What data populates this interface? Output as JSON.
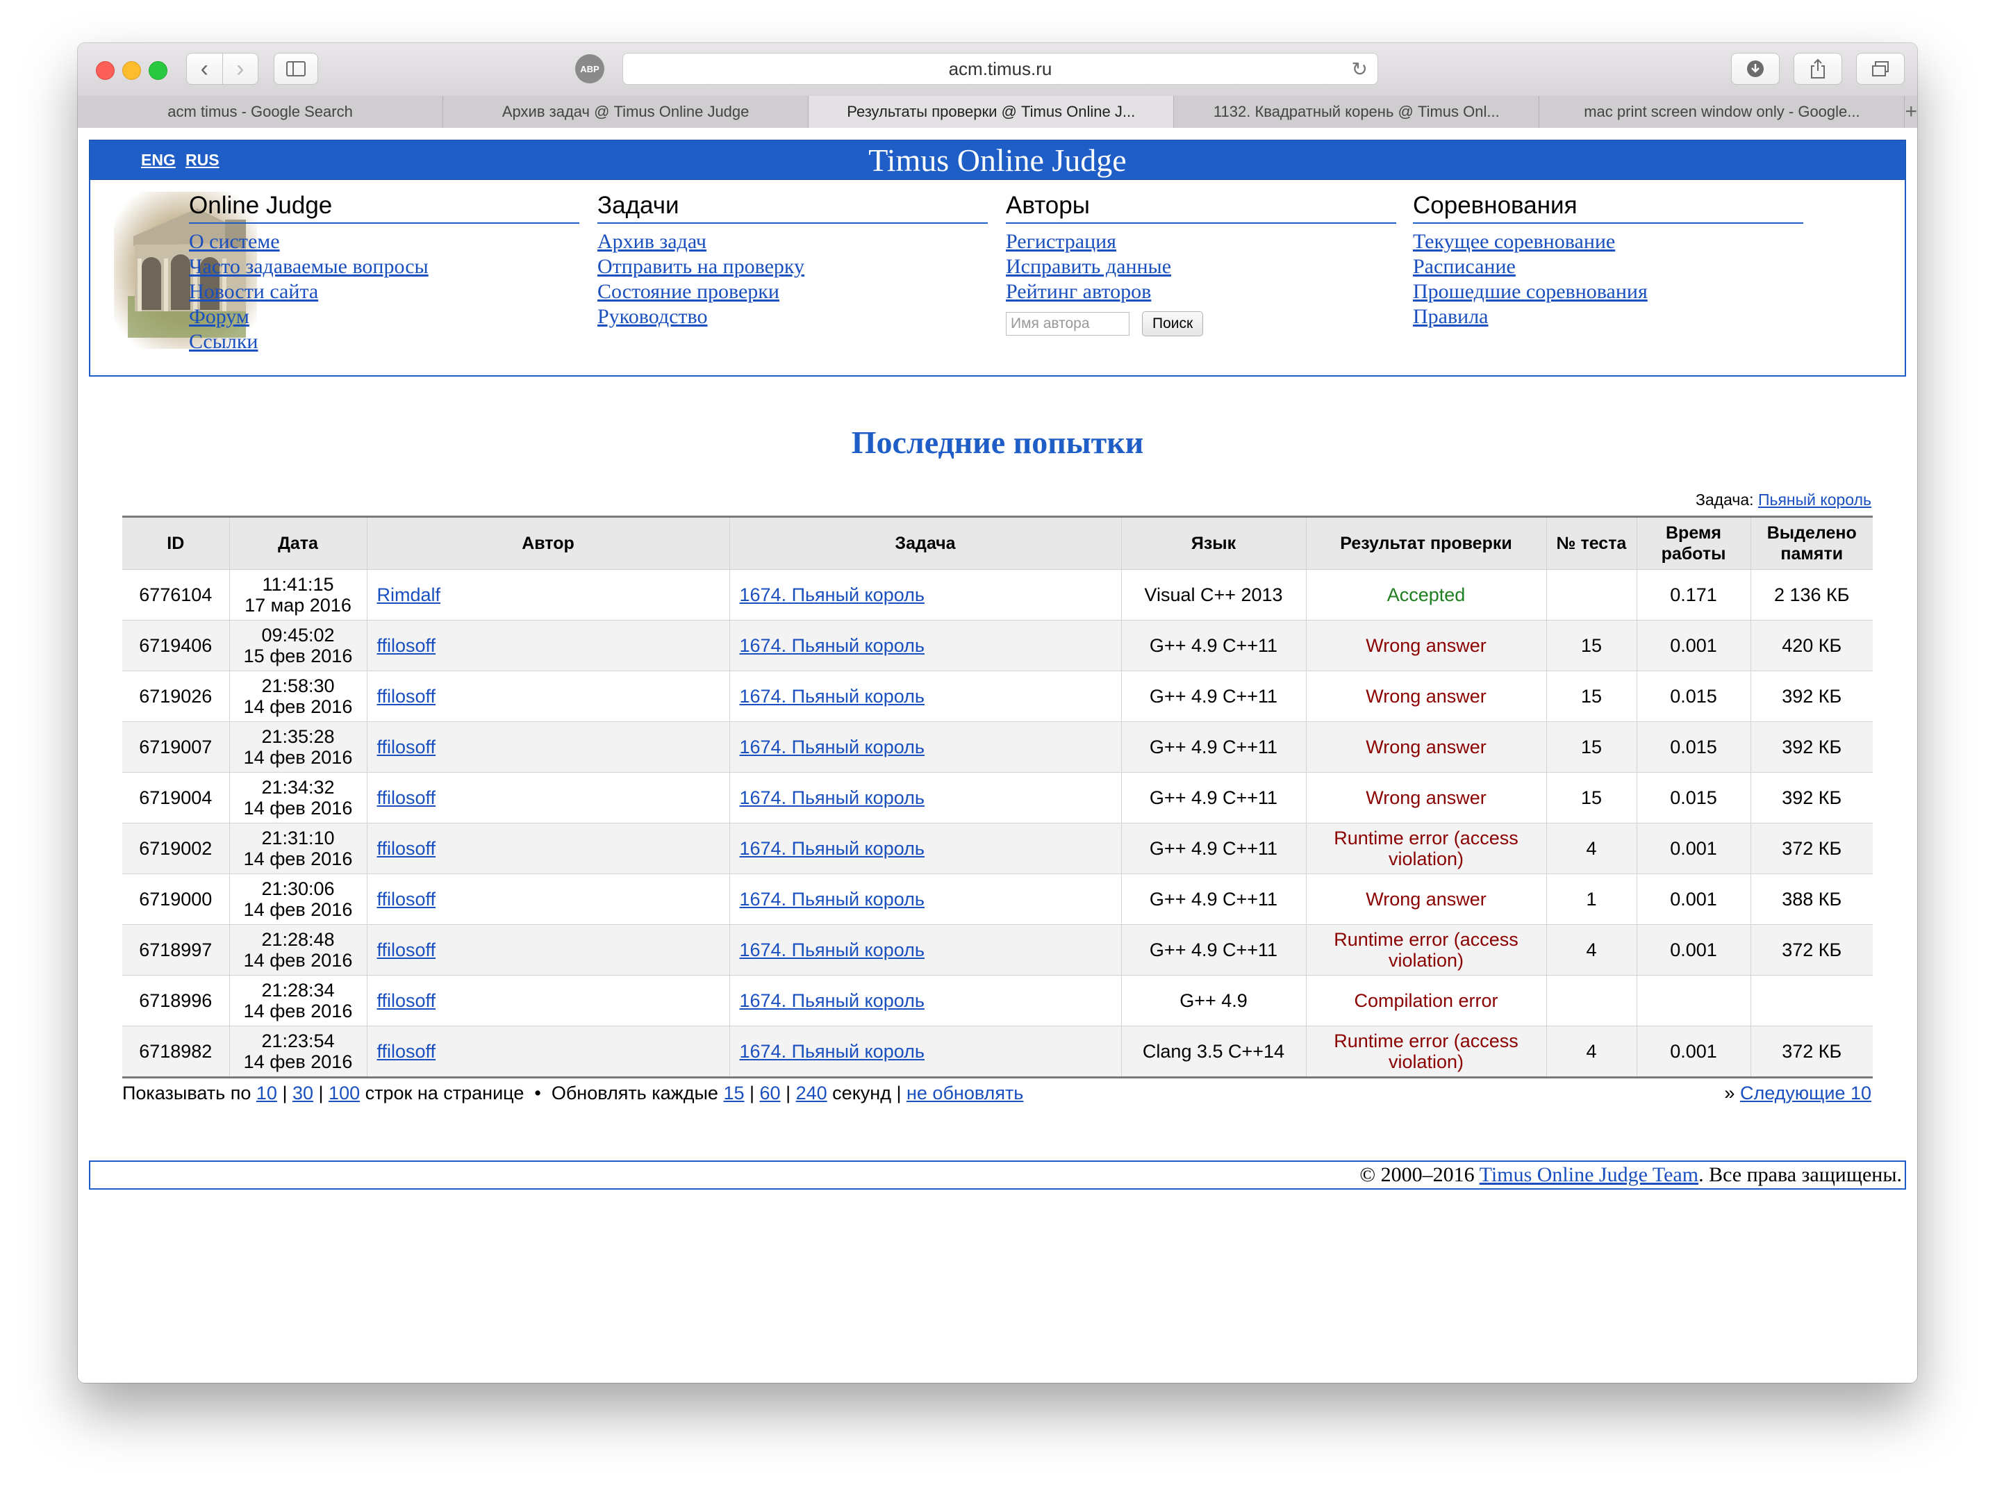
{
  "browser": {
    "url": "acm.timus.ru",
    "tabs": [
      {
        "label": "acm timus - Google Search"
      },
      {
        "label": "Архив задач @ Timus Online Judge"
      },
      {
        "label": "Результаты проверки @ Timus Online J..."
      },
      {
        "label": "1132. Квадратный корень @ Timus Onl..."
      },
      {
        "label": "mac print screen window only - Google..."
      }
    ],
    "new_tab": "+"
  },
  "header": {
    "lang_eng": "ENG",
    "lang_rus": "RUS",
    "title": "Timus Online Judge"
  },
  "menu": {
    "online_judge": {
      "title": "Online Judge",
      "links": [
        "О системе",
        "Часто задаваемые вопросы",
        "Новости сайта",
        "Форум",
        "Ссылки"
      ]
    },
    "problems": {
      "title": "Задачи",
      "links": [
        "Архив задач",
        "Отправить на проверку",
        "Состояние проверки",
        "Руководство"
      ]
    },
    "authors": {
      "title": "Авторы",
      "links": [
        "Регистрация",
        "Исправить данные",
        "Рейтинг авторов"
      ],
      "search_placeholder": "Имя автора",
      "search_button": "Поиск"
    },
    "contests": {
      "title": "Соревнования",
      "links": [
        "Текущее соревнование",
        "Расписание",
        "Прошедшие соревнования",
        "Правила"
      ]
    }
  },
  "main": {
    "heading": "Последние попытки",
    "filter_label": "Задача:",
    "filter_link": "Пьяный король",
    "columns": [
      "ID",
      "Дата",
      "Автор",
      "Задача",
      "Язык",
      "Результат проверки",
      "№ теста",
      "Время работы",
      "Выделено памяти"
    ],
    "rows": [
      {
        "id": "6776104",
        "time": "11:41:15",
        "date": "17 мар 2016",
        "author": "Rimdalf",
        "task": "1674. Пьяный король",
        "lang": "Visual C++ 2013",
        "result": "Accepted",
        "status": "ok",
        "test": "",
        "runtime": "0.171",
        "memory": "2 136 КБ"
      },
      {
        "id": "6719406",
        "time": "09:45:02",
        "date": "15 фев 2016",
        "author": "ffilosoff",
        "task": "1674. Пьяный король",
        "lang": "G++ 4.9 C++11",
        "result": "Wrong answer",
        "status": "bad",
        "test": "15",
        "runtime": "0.001",
        "memory": "420 КБ"
      },
      {
        "id": "6719026",
        "time": "21:58:30",
        "date": "14 фев 2016",
        "author": "ffilosoff",
        "task": "1674. Пьяный король",
        "lang": "G++ 4.9 C++11",
        "result": "Wrong answer",
        "status": "bad",
        "test": "15",
        "runtime": "0.015",
        "memory": "392 КБ"
      },
      {
        "id": "6719007",
        "time": "21:35:28",
        "date": "14 фев 2016",
        "author": "ffilosoff",
        "task": "1674. Пьяный король",
        "lang": "G++ 4.9 C++11",
        "result": "Wrong answer",
        "status": "bad",
        "test": "15",
        "runtime": "0.015",
        "memory": "392 КБ"
      },
      {
        "id": "6719004",
        "time": "21:34:32",
        "date": "14 фев 2016",
        "author": "ffilosoff",
        "task": "1674. Пьяный король",
        "lang": "G++ 4.9 C++11",
        "result": "Wrong answer",
        "status": "bad",
        "test": "15",
        "runtime": "0.015",
        "memory": "392 КБ"
      },
      {
        "id": "6719002",
        "time": "21:31:10",
        "date": "14 фев 2016",
        "author": "ffilosoff",
        "task": "1674. Пьяный король",
        "lang": "G++ 4.9 C++11",
        "result": "Runtime error (access violation)",
        "status": "bad",
        "test": "4",
        "runtime": "0.001",
        "memory": "372 КБ"
      },
      {
        "id": "6719000",
        "time": "21:30:06",
        "date": "14 фев 2016",
        "author": "ffilosoff",
        "task": "1674. Пьяный король",
        "lang": "G++ 4.9 C++11",
        "result": "Wrong answer",
        "status": "bad",
        "test": "1",
        "runtime": "0.001",
        "memory": "388 КБ"
      },
      {
        "id": "6718997",
        "time": "21:28:48",
        "date": "14 фев 2016",
        "author": "ffilosoff",
        "task": "1674. Пьяный король",
        "lang": "G++ 4.9 C++11",
        "result": "Runtime error (access violation)",
        "status": "bad",
        "test": "4",
        "runtime": "0.001",
        "memory": "372 КБ"
      },
      {
        "id": "6718996",
        "time": "21:28:34",
        "date": "14 фев 2016",
        "author": "ffilosoff",
        "task": "1674. Пьяный король",
        "lang": "G++ 4.9",
        "result": "Compilation error",
        "status": "bad",
        "test": "",
        "runtime": "",
        "memory": ""
      },
      {
        "id": "6718982",
        "time": "21:23:54",
        "date": "14 фев 2016",
        "author": "ffilosoff",
        "task": "1674. Пьяный король",
        "lang": "Clang 3.5 C++14",
        "result": "Runtime error (access violation)",
        "status": "bad",
        "test": "4",
        "runtime": "0.001",
        "memory": "372 КБ"
      }
    ],
    "pager": {
      "show_prefix": "Показывать по",
      "sizes": [
        "10",
        "30",
        "100"
      ],
      "rows_suffix": "строк на странице",
      "bullet": "•",
      "refresh_prefix": "Обновлять каждые",
      "refresh": [
        "15",
        "60",
        "240"
      ],
      "seconds": "секунд",
      "no_refresh": "не обновлять",
      "next_prefix": "»",
      "next_label": "Следующие 10"
    }
  },
  "footer": {
    "copyright": "© 2000–2016",
    "team_link": "Timus Online Judge Team",
    "rights": ". Все права защищены."
  },
  "colors": {
    "brand": "#1f5ec7",
    "accepted": "#1f7e1f",
    "error": "#8b0000",
    "link": "#1a4fc0"
  }
}
